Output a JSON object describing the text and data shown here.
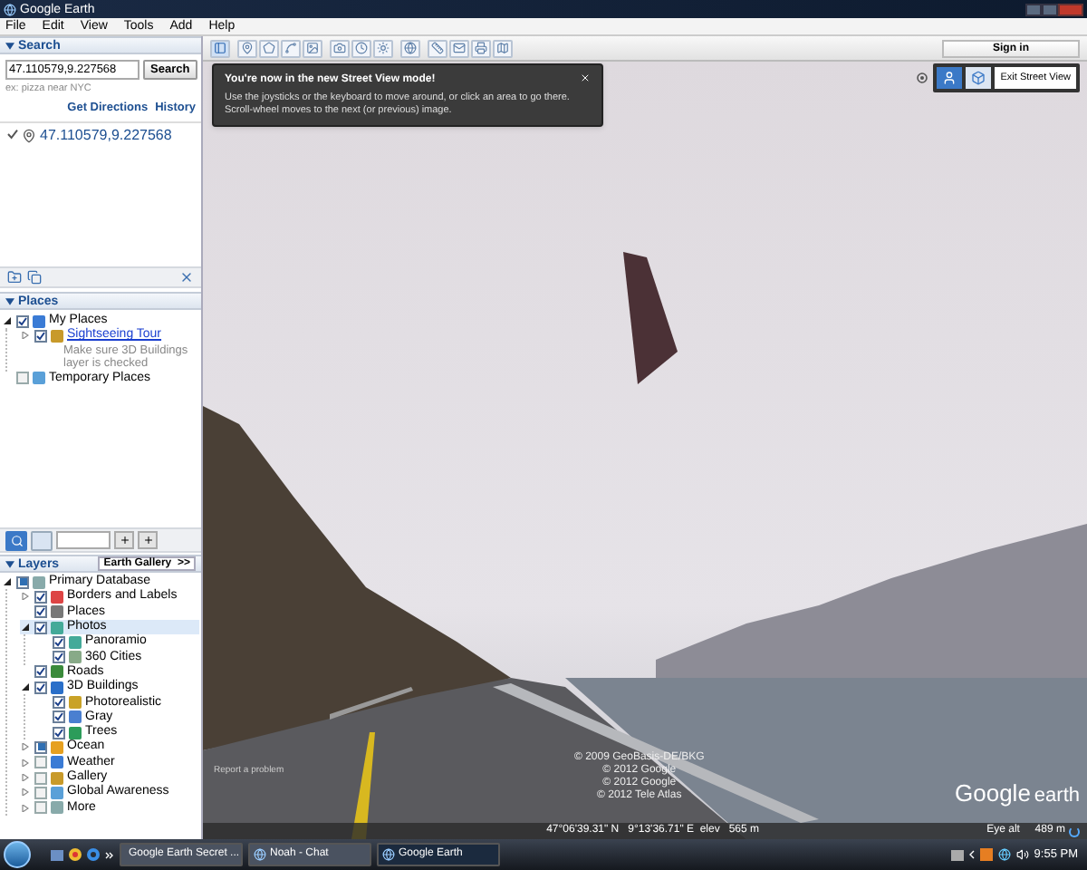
{
  "window": {
    "title": "Google Earth"
  },
  "menu": [
    "File",
    "Edit",
    "View",
    "Tools",
    "Add",
    "Help"
  ],
  "search": {
    "header": "Search",
    "value": "47.110579,9.227568",
    "button": "Search",
    "hint": "ex: pizza near NYC",
    "links": [
      "Get Directions",
      "History"
    ],
    "result": "47.110579,9.227568"
  },
  "places": {
    "header": "Places",
    "tree": [
      {
        "label": "My Places",
        "checked": true,
        "expanded": true,
        "children": [
          {
            "label": "Sightseeing Tour",
            "checked": true,
            "expanded": false,
            "link": true,
            "description": "Make sure 3D Buildings layer is checked"
          }
        ]
      },
      {
        "label": "Temporary Places",
        "checked": false
      }
    ]
  },
  "layers": {
    "header": "Layers",
    "gallery_button": "Earth Gallery  >>",
    "tree": [
      {
        "label": "Primary Database",
        "checked": true,
        "partial": true,
        "expanded": true,
        "selected": false,
        "children": [
          {
            "label": "Borders and Labels",
            "checked": true,
            "partial": false,
            "expanded": false,
            "selected": false
          },
          {
            "label": "Places",
            "checked": true,
            "partial": false,
            "selected": false
          },
          {
            "label": "Photos",
            "checked": true,
            "partial": false,
            "expanded": true,
            "selected": true,
            "children": [
              {
                "label": "Panoramio",
                "checked": true,
                "partial": false,
                "selected": false
              },
              {
                "label": "360 Cities",
                "checked": true,
                "partial": false,
                "selected": false
              }
            ]
          },
          {
            "label": "Roads",
            "checked": true,
            "partial": false,
            "selected": false
          },
          {
            "label": "3D Buildings",
            "checked": true,
            "partial": false,
            "expanded": true,
            "selected": false,
            "children": [
              {
                "label": "Photorealistic",
                "checked": true,
                "partial": false,
                "selected": false
              },
              {
                "label": "Gray",
                "checked": true,
                "partial": false,
                "selected": false
              },
              {
                "label": "Trees",
                "checked": true,
                "partial": false,
                "selected": false
              }
            ]
          },
          {
            "label": "Ocean",
            "checked": true,
            "partial": true,
            "expanded": false,
            "selected": false
          },
          {
            "label": "Weather",
            "checked": false,
            "partial": false,
            "expanded": false,
            "selected": false
          },
          {
            "label": "Gallery",
            "checked": false,
            "partial": false,
            "expanded": false,
            "selected": false
          },
          {
            "label": "Global Awareness",
            "checked": false,
            "partial": false,
            "expanded": false,
            "selected": false
          },
          {
            "label": "More",
            "checked": false,
            "partial": false,
            "expanded": false,
            "selected": false
          }
        ]
      }
    ]
  },
  "toolbar": {
    "sign_in": "Sign in"
  },
  "popup": {
    "title": "You're now in the new Street View mode!",
    "body": "Use the joysticks or the keyboard to move around, or click an area to go there. Scroll-wheel moves to the next (or previous) image."
  },
  "exit_button": "Exit Street View",
  "report_link": "Report a problem",
  "copyrights": [
    "© 2009 GeoBasis-DE/BKG",
    "© 2012 Google",
    "© 2012 Google",
    "© 2012 Tele Atlas"
  ],
  "logo": {
    "word1": "Google",
    "word2": "earth"
  },
  "status": {
    "coordinates": "47°06'39.31\" N   9°13'36.71\" E  elev   565 m",
    "eye_alt": "Eye alt     489 m"
  },
  "taskbar": {
    "items": [
      {
        "label": "Google Earth Secret ...",
        "selected": false
      },
      {
        "label": "Noah - Chat",
        "selected": false
      },
      {
        "label": "Google Earth",
        "selected": true
      }
    ],
    "time": "9:55 PM"
  }
}
